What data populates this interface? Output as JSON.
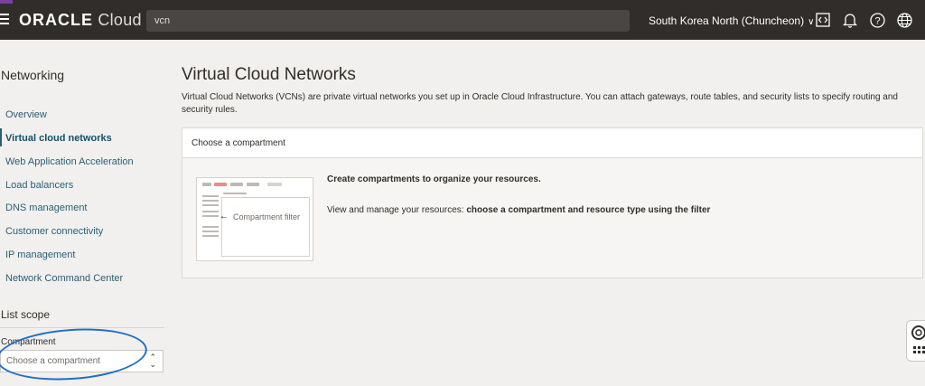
{
  "header": {
    "brand_strong": "ORACLE",
    "brand_light": "Cloud",
    "search_value": "vcn",
    "region": "South Korea North (Chuncheon)",
    "icons": [
      "menu-icon",
      "code-editor-icon",
      "bell-icon",
      "help-icon",
      "globe-icon"
    ]
  },
  "sidebar": {
    "title": "Networking",
    "items": [
      {
        "label": "Overview"
      },
      {
        "label": "Virtual cloud networks",
        "active": true
      },
      {
        "label": "Web Application Acceleration"
      },
      {
        "label": "Load balancers"
      },
      {
        "label": "DNS management"
      },
      {
        "label": "Customer connectivity"
      },
      {
        "label": "IP management"
      },
      {
        "label": "Network Command Center"
      }
    ],
    "scope_title": "List scope",
    "compartment_label": "Compartment",
    "compartment_placeholder": "Choose a compartment"
  },
  "main": {
    "title": "Virtual Cloud Networks",
    "description": "Virtual Cloud Networks (VCNs) are private virtual networks you set up in Oracle Cloud Infrastructure. You can attach gateways, route tables, and security lists to specify routing and security rules.",
    "panel_header": "Choose a compartment",
    "illustration_label": "Compartment filter",
    "cta_title": "Create compartments to organize your resources.",
    "cta_desc_prefix": "View and manage your resources: ",
    "cta_desc_bold": "choose a compartment and resource type using the filter"
  },
  "colors": {
    "topbar": "#312d2a",
    "link": "#2c5e75",
    "annotation": "#1e6fc7"
  }
}
